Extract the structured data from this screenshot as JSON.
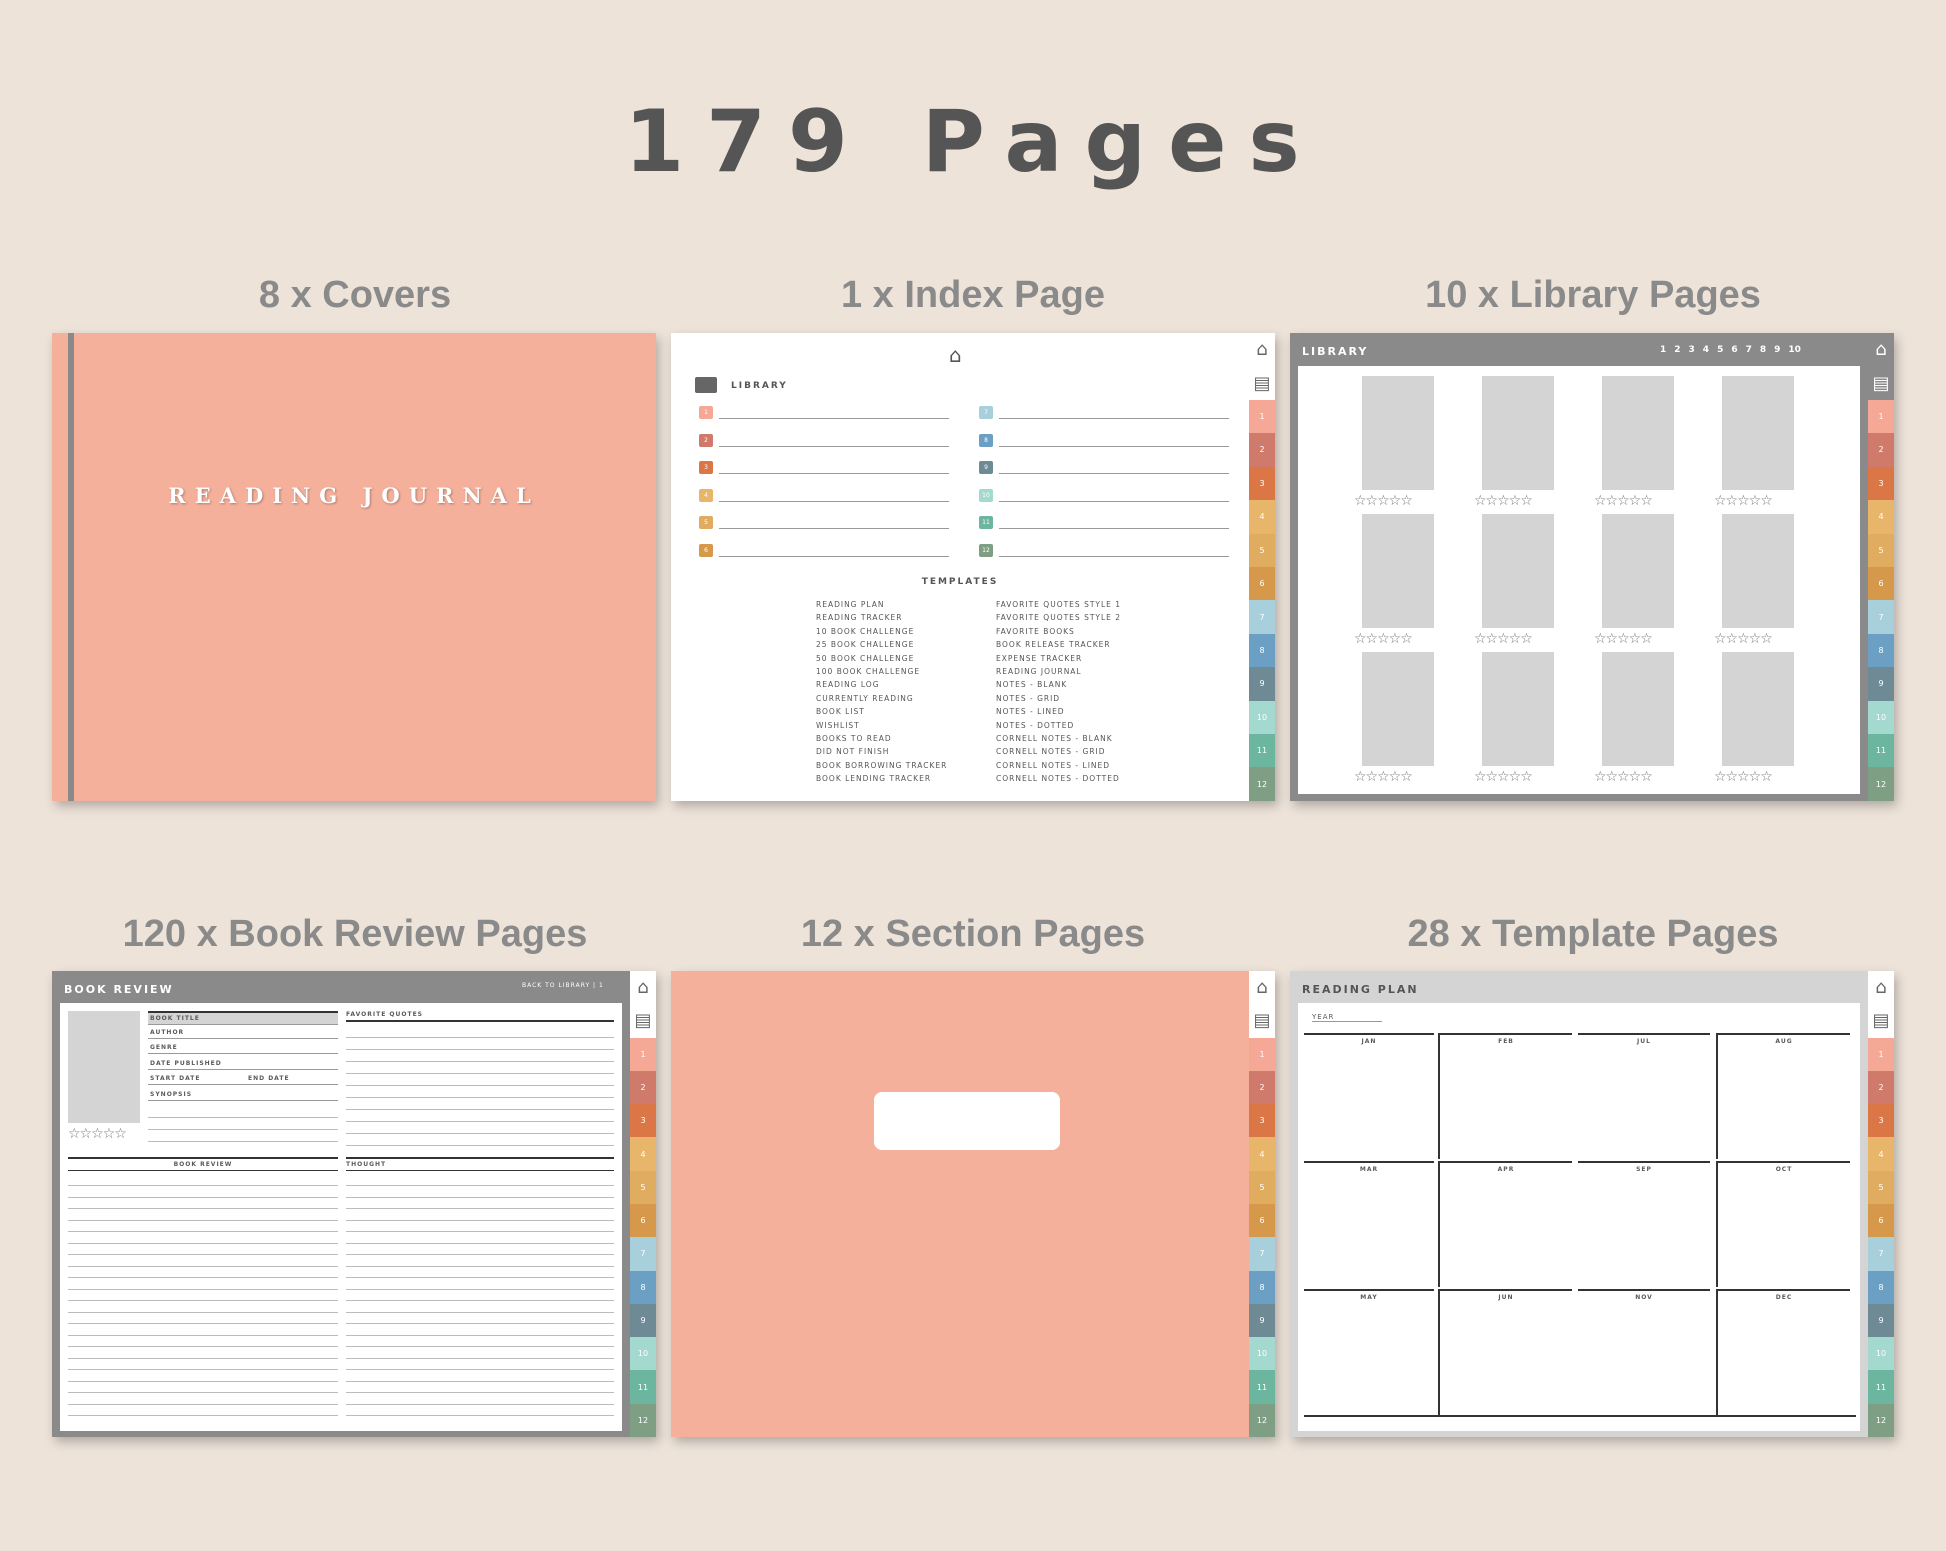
{
  "title": "179 Pages",
  "panels": {
    "covers": "8 x Covers",
    "index": "1 x Index Page",
    "library": "10 x Library Pages",
    "review": "120 x Book Review Pages",
    "section": "12 x Section Pages",
    "template": "28 x Template Pages"
  },
  "colors": {
    "peach": "#f5b09b",
    "tabs": [
      "#f5a896",
      "#cf7a6b",
      "#db7746",
      "#e8b66a",
      "#e0ad60",
      "#d6984a",
      "#a8cfdc",
      "#6b9fc4",
      "#6e8a95",
      "#a3d9cf",
      "#6cb59f",
      "#7e9f84"
    ]
  },
  "tab_numbers": [
    "1",
    "2",
    "3",
    "4",
    "5",
    "6",
    "7",
    "8",
    "9",
    "10",
    "11",
    "12"
  ],
  "cover": {
    "text": "READING JOURNAL"
  },
  "index": {
    "library_label": "LIBRARY",
    "templates_label": "TEMPLATES",
    "left_templates": [
      "READING PLAN",
      "READING TRACKER",
      "10 BOOK CHALLENGE",
      "25 BOOK CHALLENGE",
      "50 BOOK CHALLENGE",
      "100 BOOK CHALLENGE",
      "READING LOG",
      "CURRENTLY READING",
      "BOOK LIST",
      "WISHLIST",
      "BOOKS TO READ",
      "DID NOT FINISH",
      "BOOK BORROWING TRACKER",
      "BOOK LENDING TRACKER"
    ],
    "right_templates": [
      "FAVORITE QUOTES STYLE 1",
      "FAVORITE QUOTES STYLE 2",
      "FAVORITE BOOKS",
      "BOOK RELEASE TRACKER",
      "EXPENSE TRACKER",
      "READING JOURNAL",
      "NOTES - BLANK",
      "NOTES - GRID",
      "NOTES - LINED",
      "NOTES - DOTTED",
      "CORNELL NOTES - BLANK",
      "CORNELL NOTES - GRID",
      "CORNELL NOTES - LINED",
      "CORNELL NOTES - DOTTED"
    ]
  },
  "library": {
    "header": "LIBRARY",
    "pages": [
      "1",
      "2",
      "3",
      "4",
      "5",
      "6",
      "7",
      "8",
      "9",
      "10"
    ],
    "stars": "☆☆☆☆☆"
  },
  "review": {
    "header": "BOOK REVIEW",
    "back": "BACK TO LIBRARY | 1",
    "fields": [
      "BOOK TITLE",
      "AUTHOR",
      "GENRE",
      "DATE PUBLISHED",
      "START DATE",
      "SYNOPSIS"
    ],
    "end_date": "END DATE",
    "quotes": "FAVORITE QUOTES",
    "book_review": "BOOK REVIEW",
    "thought": "THOUGHT",
    "stars": "☆☆☆☆☆"
  },
  "plan": {
    "header": "READING PLAN",
    "year": "YEAR",
    "months": [
      "JAN",
      "FEB",
      "JUL",
      "AUG",
      "MAR",
      "APR",
      "SEP",
      "OCT",
      "MAY",
      "JUN",
      "NOV",
      "DEC"
    ]
  },
  "icons": {
    "home": "home-icon",
    "book": "open-book-icon"
  }
}
